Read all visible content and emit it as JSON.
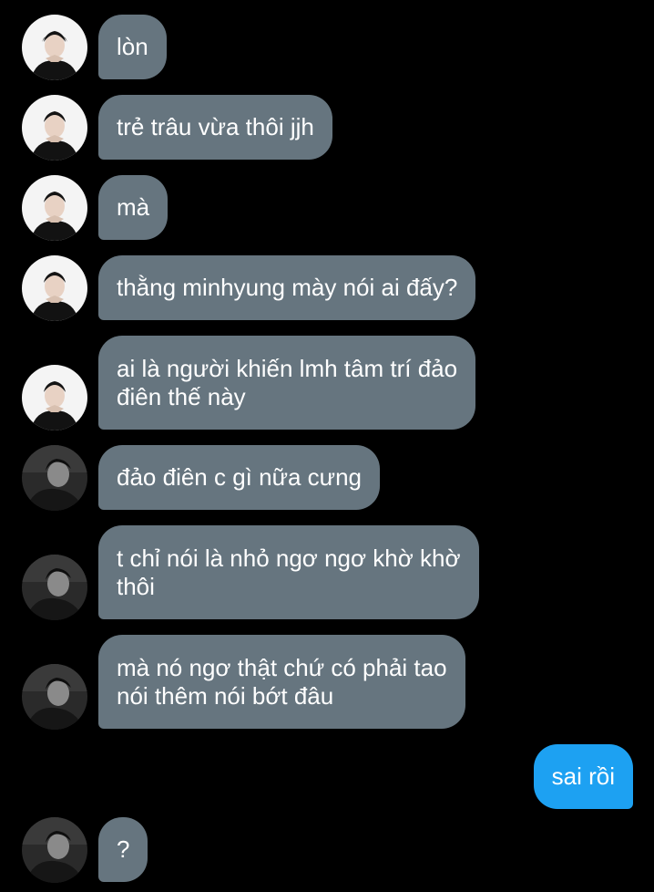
{
  "conversation": {
    "messages": [
      {
        "direction": "received",
        "avatar": "user-a-photo",
        "lines": [
          "lòn"
        ]
      },
      {
        "direction": "received",
        "avatar": "user-a-photo",
        "lines": [
          "trẻ trâu vừa thôi jjh"
        ]
      },
      {
        "direction": "received",
        "avatar": "user-a-photo",
        "lines": [
          "mà"
        ]
      },
      {
        "direction": "received",
        "avatar": "user-a-photo",
        "lines": [
          "thằng minhyung mày nói ai đấy?"
        ]
      },
      {
        "direction": "received",
        "avatar": "user-a-photo",
        "lines": [
          "ai là người khiến lmh tâm trí đảo",
          "điên thế này"
        ]
      },
      {
        "direction": "received",
        "avatar": "user-b-photo",
        "lines": [
          "đảo điên c gì nữa cưng"
        ]
      },
      {
        "direction": "received",
        "avatar": "user-b-photo",
        "lines": [
          "t chỉ nói là nhỏ ngơ ngơ khờ khờ",
          "thôi"
        ]
      },
      {
        "direction": "received",
        "avatar": "user-b-photo",
        "lines": [
          "mà nó ngơ thật chứ có phải tao",
          "nói thêm nói bớt đâu"
        ]
      },
      {
        "direction": "sent",
        "lines": [
          "sai rồi"
        ]
      },
      {
        "direction": "received",
        "avatar": "user-b-photo",
        "lines": [
          "?"
        ]
      }
    ]
  },
  "colors": {
    "background": "#000000",
    "received_bubble": "#66757f",
    "sent_bubble": "#1da1f2",
    "text": "#ffffff"
  }
}
